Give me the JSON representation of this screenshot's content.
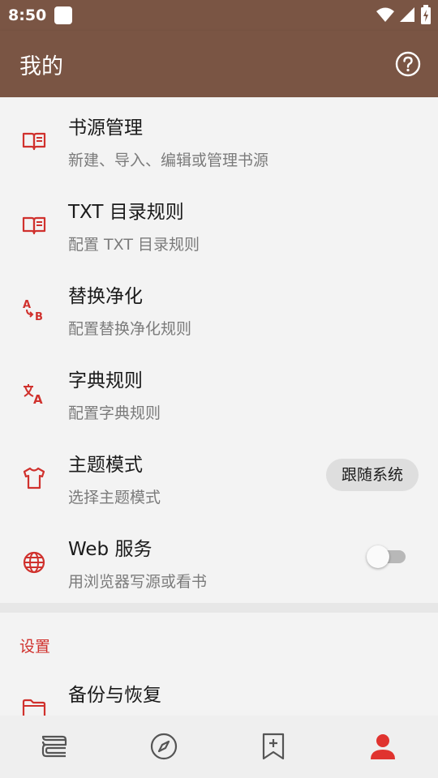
{
  "status_bar": {
    "time": "8:50",
    "icons": [
      "notification-square-icon",
      "wifi-icon",
      "signal-icon",
      "battery-charging-icon"
    ]
  },
  "app_bar": {
    "title": "我的",
    "help_icon": "help-circle-icon"
  },
  "menu": {
    "items": [
      {
        "title": "书源管理",
        "subtitle": "新建、导入、编辑或管理书源",
        "icon": "book-open-icon"
      },
      {
        "title": "TXT 目录规则",
        "subtitle": "配置 TXT 目录规则",
        "icon": "book-open-icon"
      },
      {
        "title": "替换净化",
        "subtitle": "配置替换净化规则",
        "icon": "a-to-b-replace-icon"
      },
      {
        "title": "字典规则",
        "subtitle": "配置字典规则",
        "icon": "translate-icon"
      },
      {
        "title": "主题模式",
        "subtitle": "选择主题模式",
        "icon": "tshirt-icon",
        "value": "跟随系统"
      },
      {
        "title": "Web 服务",
        "subtitle": "用浏览器写源或看书",
        "icon": "globe-icon",
        "enabled": false
      }
    ]
  },
  "settings": {
    "header": "设置",
    "items": [
      {
        "title": "备份与恢复",
        "icon": "folder-icon"
      }
    ]
  },
  "bottom_nav": {
    "items": [
      {
        "icon": "bookshelf-icon",
        "active": false
      },
      {
        "icon": "compass-icon",
        "active": false
      },
      {
        "icon": "bookmark-add-icon",
        "active": false
      },
      {
        "icon": "person-icon",
        "active": true
      }
    ]
  },
  "colors": {
    "primary": "#7a5544",
    "accent": "#d0312d",
    "background": "#f3f3f3"
  }
}
